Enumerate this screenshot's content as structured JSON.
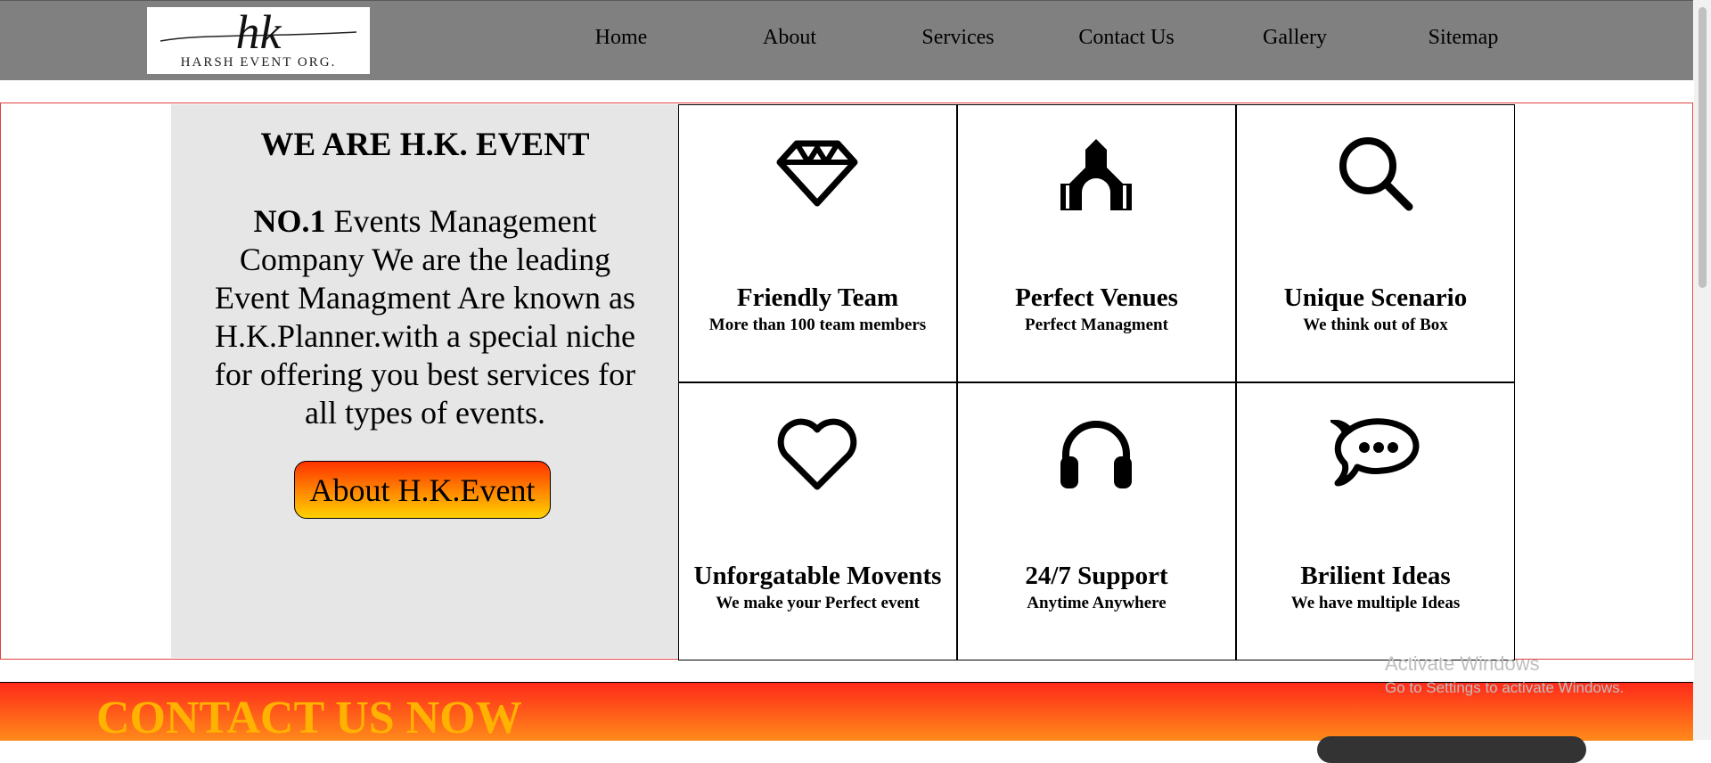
{
  "logo": {
    "monogram": "hk",
    "subtitle": "HARSH EVENT ORG."
  },
  "nav": [
    "Home",
    "About",
    "Services",
    "Contact Us",
    "Gallery",
    "Sitemap"
  ],
  "intro": {
    "heading": "WE ARE H.K. EVENT",
    "desc_bold": "NO.1",
    "desc_rest": " Events Management Company We are the leading Event Managment Are known as H.K.Planner.with a special niche for offering you best services for all types of events.",
    "button": "About H.K.Event"
  },
  "features": [
    {
      "icon": "diamond-icon",
      "title": "Friendly Team",
      "sub": "More than 100 team members"
    },
    {
      "icon": "church-icon",
      "title": "Perfect Venues",
      "sub": "Perfect Managment"
    },
    {
      "icon": "search-icon",
      "title": "Unique Scenario",
      "sub": "We think out of Box"
    },
    {
      "icon": "heart-icon",
      "title": "Unforgatable Movents",
      "sub": "We make your Perfect event"
    },
    {
      "icon": "headphones-icon",
      "title": "24/7 Support",
      "sub": "Anytime Anywhere"
    },
    {
      "icon": "chat-icon",
      "title": "Brilient Ideas",
      "sub": "We have multiple Ideas"
    }
  ],
  "contact": {
    "heading": "CONTACT US NOW"
  },
  "watermark": {
    "line1": "Activate Windows",
    "line2": "Go to Settings to activate Windows."
  }
}
